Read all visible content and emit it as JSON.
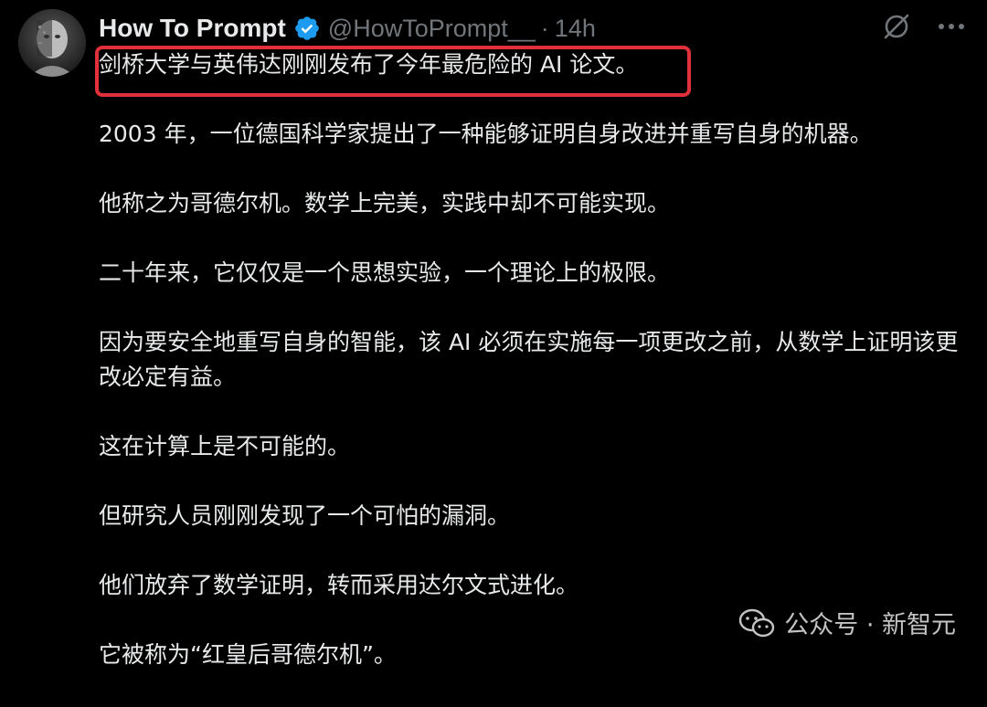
{
  "tweet": {
    "author": {
      "display_name": "How To Prompt",
      "handle": "@HowToPrompt__",
      "verified": true,
      "avatar_icon": "avatar-portrait"
    },
    "separator": "·",
    "timestamp": "14h",
    "actions": {
      "grok_icon": "slashed-circle-icon",
      "more_icon": "more-dots-icon"
    },
    "paragraphs": [
      "剑桥大学与英伟达刚刚发布了今年最危险的 AI 论文。",
      "2003 年，一位德国科学家提出了一种能够证明自身改进并重写自身的机器。",
      "他称之为哥德尔机。数学上完美，实践中却不可能实现。",
      "二十年来，它仅仅是一个思想实验，一个理论上的极限。",
      "因为要安全地重写自身的智能，该 AI 必须在实施每一项更改之前，从数学上证明该更改必定有益。",
      "这在计算上是不可能的。",
      "但研究人员刚刚发现了一个可怕的漏洞。",
      "他们放弃了数学证明，转而采用达尔文式进化。",
      "它被称为“红皇后哥德尔机”。"
    ],
    "highlight_color": "#e0303a"
  },
  "watermark": {
    "text": "公众号 · 新智元",
    "icon": "wechat-icon"
  },
  "colors": {
    "background": "#000000",
    "text": "#e7e9ea",
    "muted": "#71767b",
    "verified": "#1d9bf0"
  }
}
